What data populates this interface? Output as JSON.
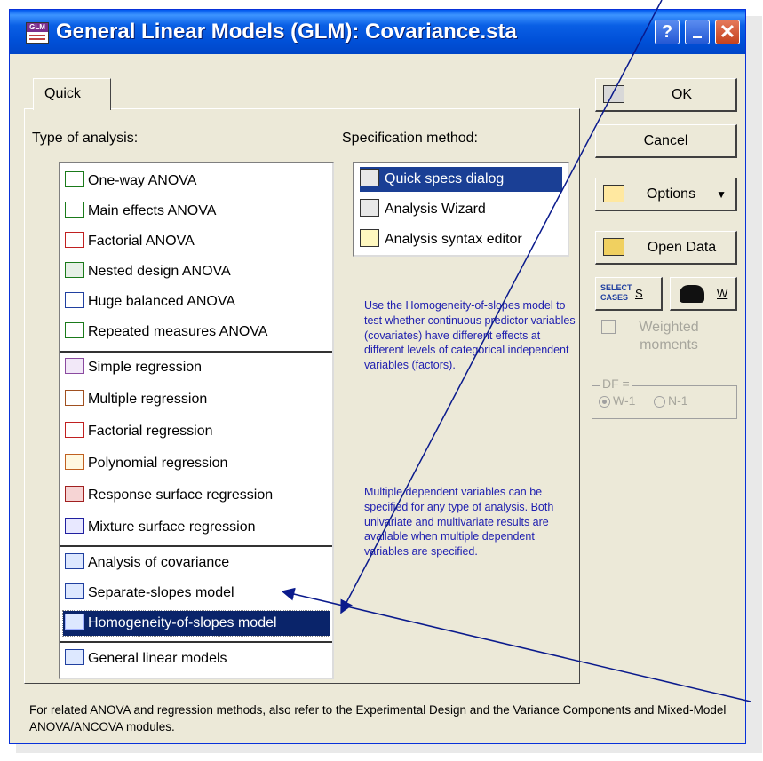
{
  "window": {
    "title": "General Linear Models (GLM): Covariance.sta",
    "app_icon": "GLM"
  },
  "titlebar_buttons": {
    "help": "?",
    "close": "✕"
  },
  "tab": {
    "label": "Quick"
  },
  "analysis": {
    "label": "Type of analysis:",
    "groups": [
      [
        "One-way ANOVA",
        "Main effects ANOVA",
        "Factorial ANOVA",
        "Nested design ANOVA",
        "Huge balanced ANOVA",
        "Repeated measures ANOVA"
      ],
      [
        "Simple regression",
        "Multiple regression",
        "Factorial regression",
        "Polynomial regression",
        "Response surface regression",
        "Mixture surface regression"
      ],
      [
        "Analysis of covariance",
        "Separate-slopes model",
        "Homogeneity-of-slopes model"
      ],
      [
        "General linear models"
      ]
    ],
    "selected": "Homogeneity-of-slopes model"
  },
  "specification": {
    "label": "Specification method:",
    "items": [
      "Quick specs dialog",
      "Analysis Wizard",
      "Analysis syntax editor"
    ],
    "selected": "Quick specs dialog"
  },
  "description": {
    "p1": "Use the Homogeneity-of-slopes model to test whether continuous predictor variables (covariates) have different effects at different levels of categorical independent variables (factors).",
    "p2": "Multiple dependent variables can be specified for any type of analysis.  Both univariate and multivariate results are available when multiple dependent variables are specified."
  },
  "buttons": {
    "ok": "OK",
    "cancel": "Cancel",
    "options": "Options",
    "options_arrow": "▼",
    "open_data": "Open Data",
    "select_cases_icon": "SELECT CASES",
    "select_cases_key": "S",
    "weight_key": "W"
  },
  "weighted": {
    "label": "Weighted moments",
    "checked": false,
    "enabled": false
  },
  "df": {
    "label": "DF =",
    "options": [
      "W-1",
      "N-1"
    ],
    "selected": "W-1"
  },
  "footer": "For related ANOVA and regression methods, also refer to the Experimental Design and the Variance Components and Mixed-Model ANOVA/ANCOVA modules.",
  "colors": {
    "titlebar": "#0a5fe5",
    "selection": "#0a246a",
    "description_text": "#2020b0",
    "annotation_arrows": "#0a1a8c"
  }
}
